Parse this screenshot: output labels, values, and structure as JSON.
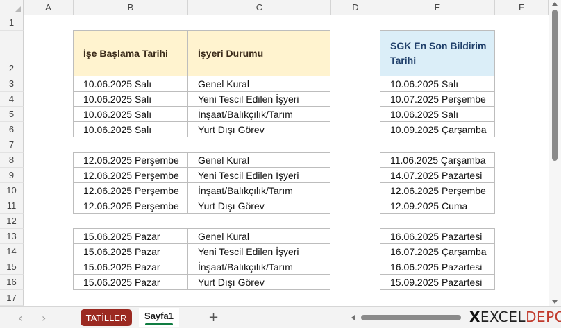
{
  "columns": [
    "A",
    "B",
    "C",
    "D",
    "E",
    "F"
  ],
  "rows": [
    "1",
    "2",
    "3",
    "4",
    "5",
    "6",
    "7",
    "8",
    "9",
    "10",
    "11",
    "12",
    "13",
    "14",
    "15",
    "16",
    "17"
  ],
  "headers": {
    "start_date": "İşe Başlama Tarihi",
    "workplace_status": "İşyeri Durumu",
    "sgk_date": "SGK En Son Bildirim Tarihi"
  },
  "groups": [
    {
      "rows": [
        {
          "start": "10.06.2025 Salı",
          "status": "Genel Kural",
          "sgk": "10.06.2025 Salı"
        },
        {
          "start": "10.06.2025 Salı",
          "status": "Yeni Tescil Edilen İşyeri",
          "sgk": "10.07.2025 Perşembe"
        },
        {
          "start": "10.06.2025 Salı",
          "status": "İnşaat/Balıkçılık/Tarım",
          "sgk": "10.06.2025 Salı"
        },
        {
          "start": "10.06.2025 Salı",
          "status": "Yurt Dışı Görev",
          "sgk": "10.09.2025 Çarşamba"
        }
      ]
    },
    {
      "rows": [
        {
          "start": "12.06.2025 Perşembe",
          "status": "Genel Kural",
          "sgk": "11.06.2025 Çarşamba"
        },
        {
          "start": "12.06.2025 Perşembe",
          "status": "Yeni Tescil Edilen İşyeri",
          "sgk": "14.07.2025 Pazartesi"
        },
        {
          "start": "12.06.2025 Perşembe",
          "status": "İnşaat/Balıkçılık/Tarım",
          "sgk": "12.06.2025 Perşembe"
        },
        {
          "start": "12.06.2025 Perşembe",
          "status": "Yurt Dışı Görev",
          "sgk": "12.09.2025 Cuma"
        }
      ]
    },
    {
      "rows": [
        {
          "start": "15.06.2025 Pazar",
          "status": "Genel Kural",
          "sgk": "16.06.2025 Pazartesi"
        },
        {
          "start": "15.06.2025 Pazar",
          "status": "Yeni Tescil Edilen İşyeri",
          "sgk": "16.07.2025 Çarşamba"
        },
        {
          "start": "15.06.2025 Pazar",
          "status": "İnşaat/Balıkçılık/Tarım",
          "sgk": "16.06.2025 Pazartesi"
        },
        {
          "start": "15.06.2025 Pazar",
          "status": "Yurt Dışı Görev",
          "sgk": "15.09.2025 Pazartesi"
        }
      ]
    }
  ],
  "tabs": {
    "prev": "‹",
    "next": "›",
    "tatiller": "TATİLLER",
    "sayfa1": "Sayfa1",
    "add": "+"
  },
  "logo": {
    "x": "X",
    "excel": "EXCEL",
    "depo": "DEPO"
  },
  "colors": {
    "header_yellow": "#fff3cf",
    "header_blue": "#dbeef8",
    "tab_red": "#9b2a22",
    "active_tab_underline": "#107c41",
    "logo_red": "#c0392b"
  }
}
